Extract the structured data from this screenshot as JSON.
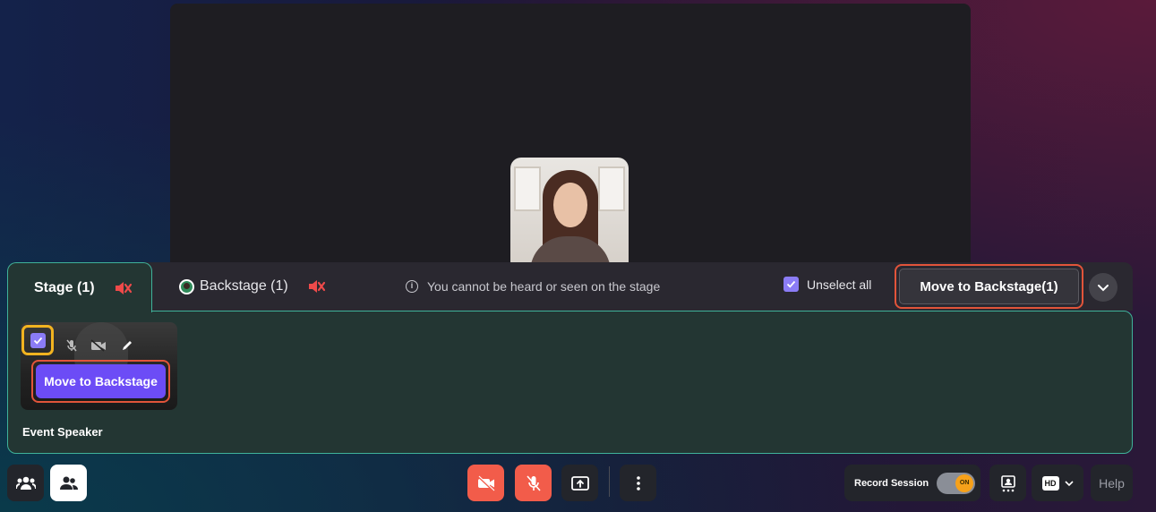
{
  "tabs": {
    "stage_label": "Stage (1)",
    "backstage_label": "Backstage (1)"
  },
  "notice": "You cannot be heard or seen on the stage",
  "selection": {
    "unselect_all_label": "Unselect all",
    "unselect_all_checked": true
  },
  "actions": {
    "move_all_label": "Move to Backstage(1)",
    "tile_move_label": "Move to Backstage"
  },
  "participant": {
    "name": "Event Speaker",
    "selected": true
  },
  "toolbar": {
    "record_label": "Record Session",
    "record_toggle": "ON",
    "quality_badge": "HD",
    "help_label": "Help"
  },
  "colors": {
    "accent_teal": "#3fb29a",
    "highlight_orange": "#e2543a",
    "highlight_yellow": "#f2b320",
    "primary_purple": "#6c4cf6",
    "danger_red": "#f25c4a"
  }
}
